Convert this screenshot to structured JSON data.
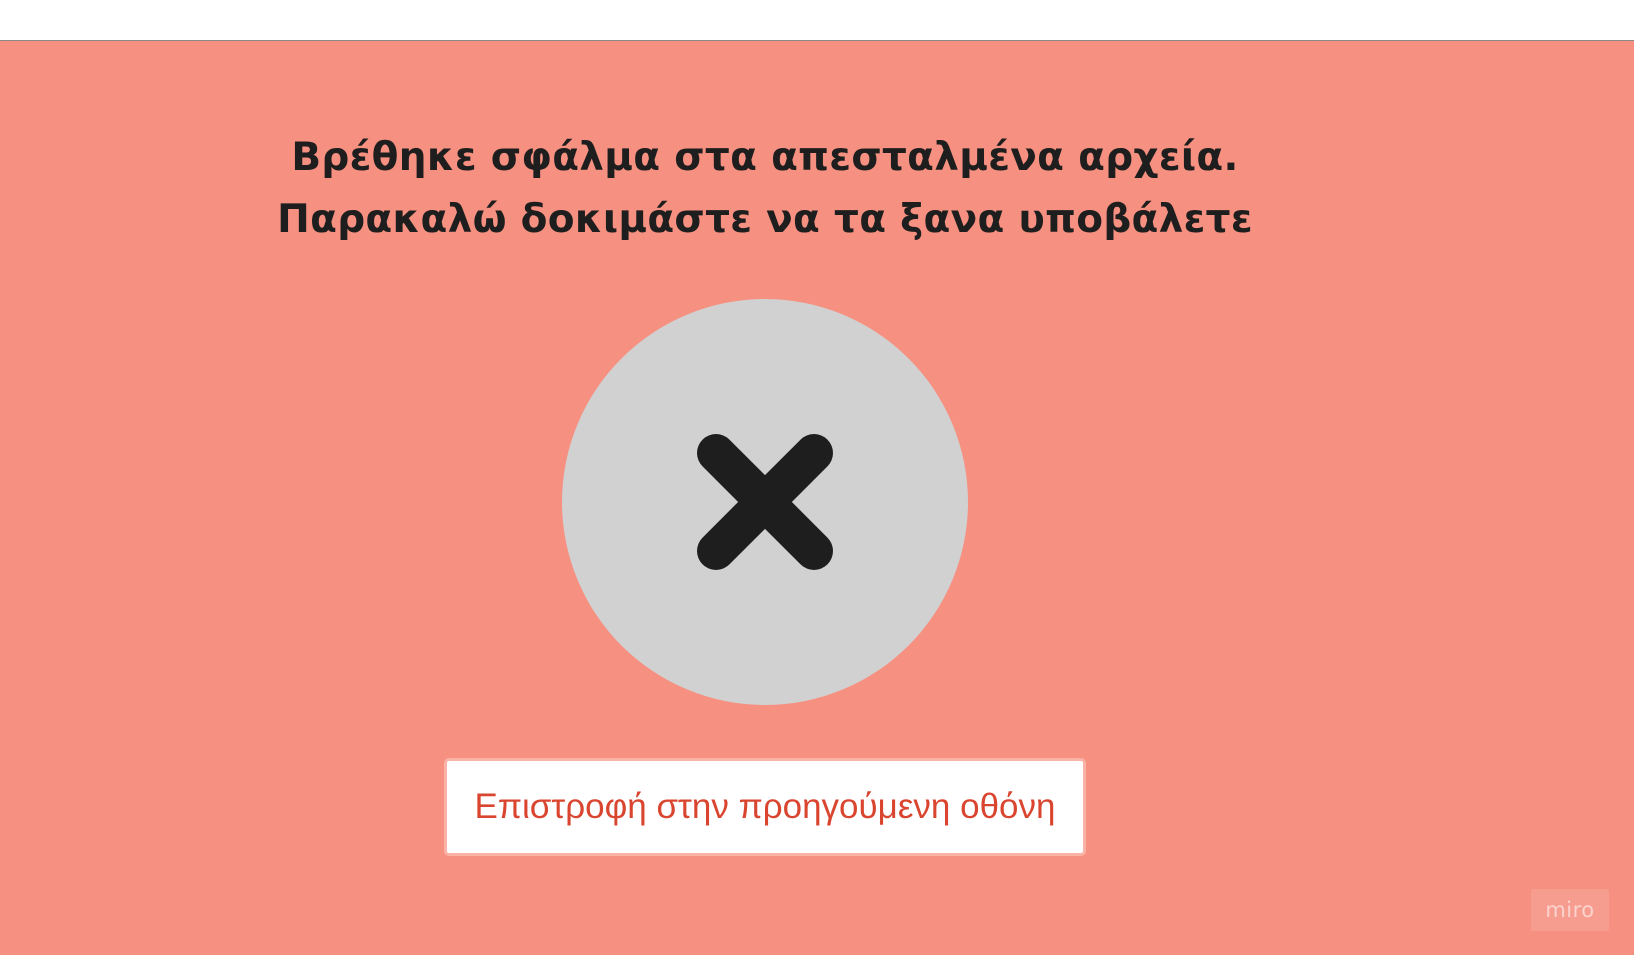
{
  "error": {
    "line1": "Βρέθηκε σφάλμα στα απεσταλμένα αρχεία.",
    "line2": "Παρακαλώ δοκιμάστε να τα ξανα υποβάλετε"
  },
  "status_icon": "close-icon",
  "actions": {
    "back_label": "Επιστροφή στην προηγούμενη οθόνη"
  },
  "brand": {
    "badge_text": "miro"
  },
  "colors": {
    "panel_background": "#f69080",
    "circle": "#d1d1d1",
    "icon": "#1e1e1e",
    "button_text": "#d9452f",
    "button_border": "#fbb3a8"
  }
}
